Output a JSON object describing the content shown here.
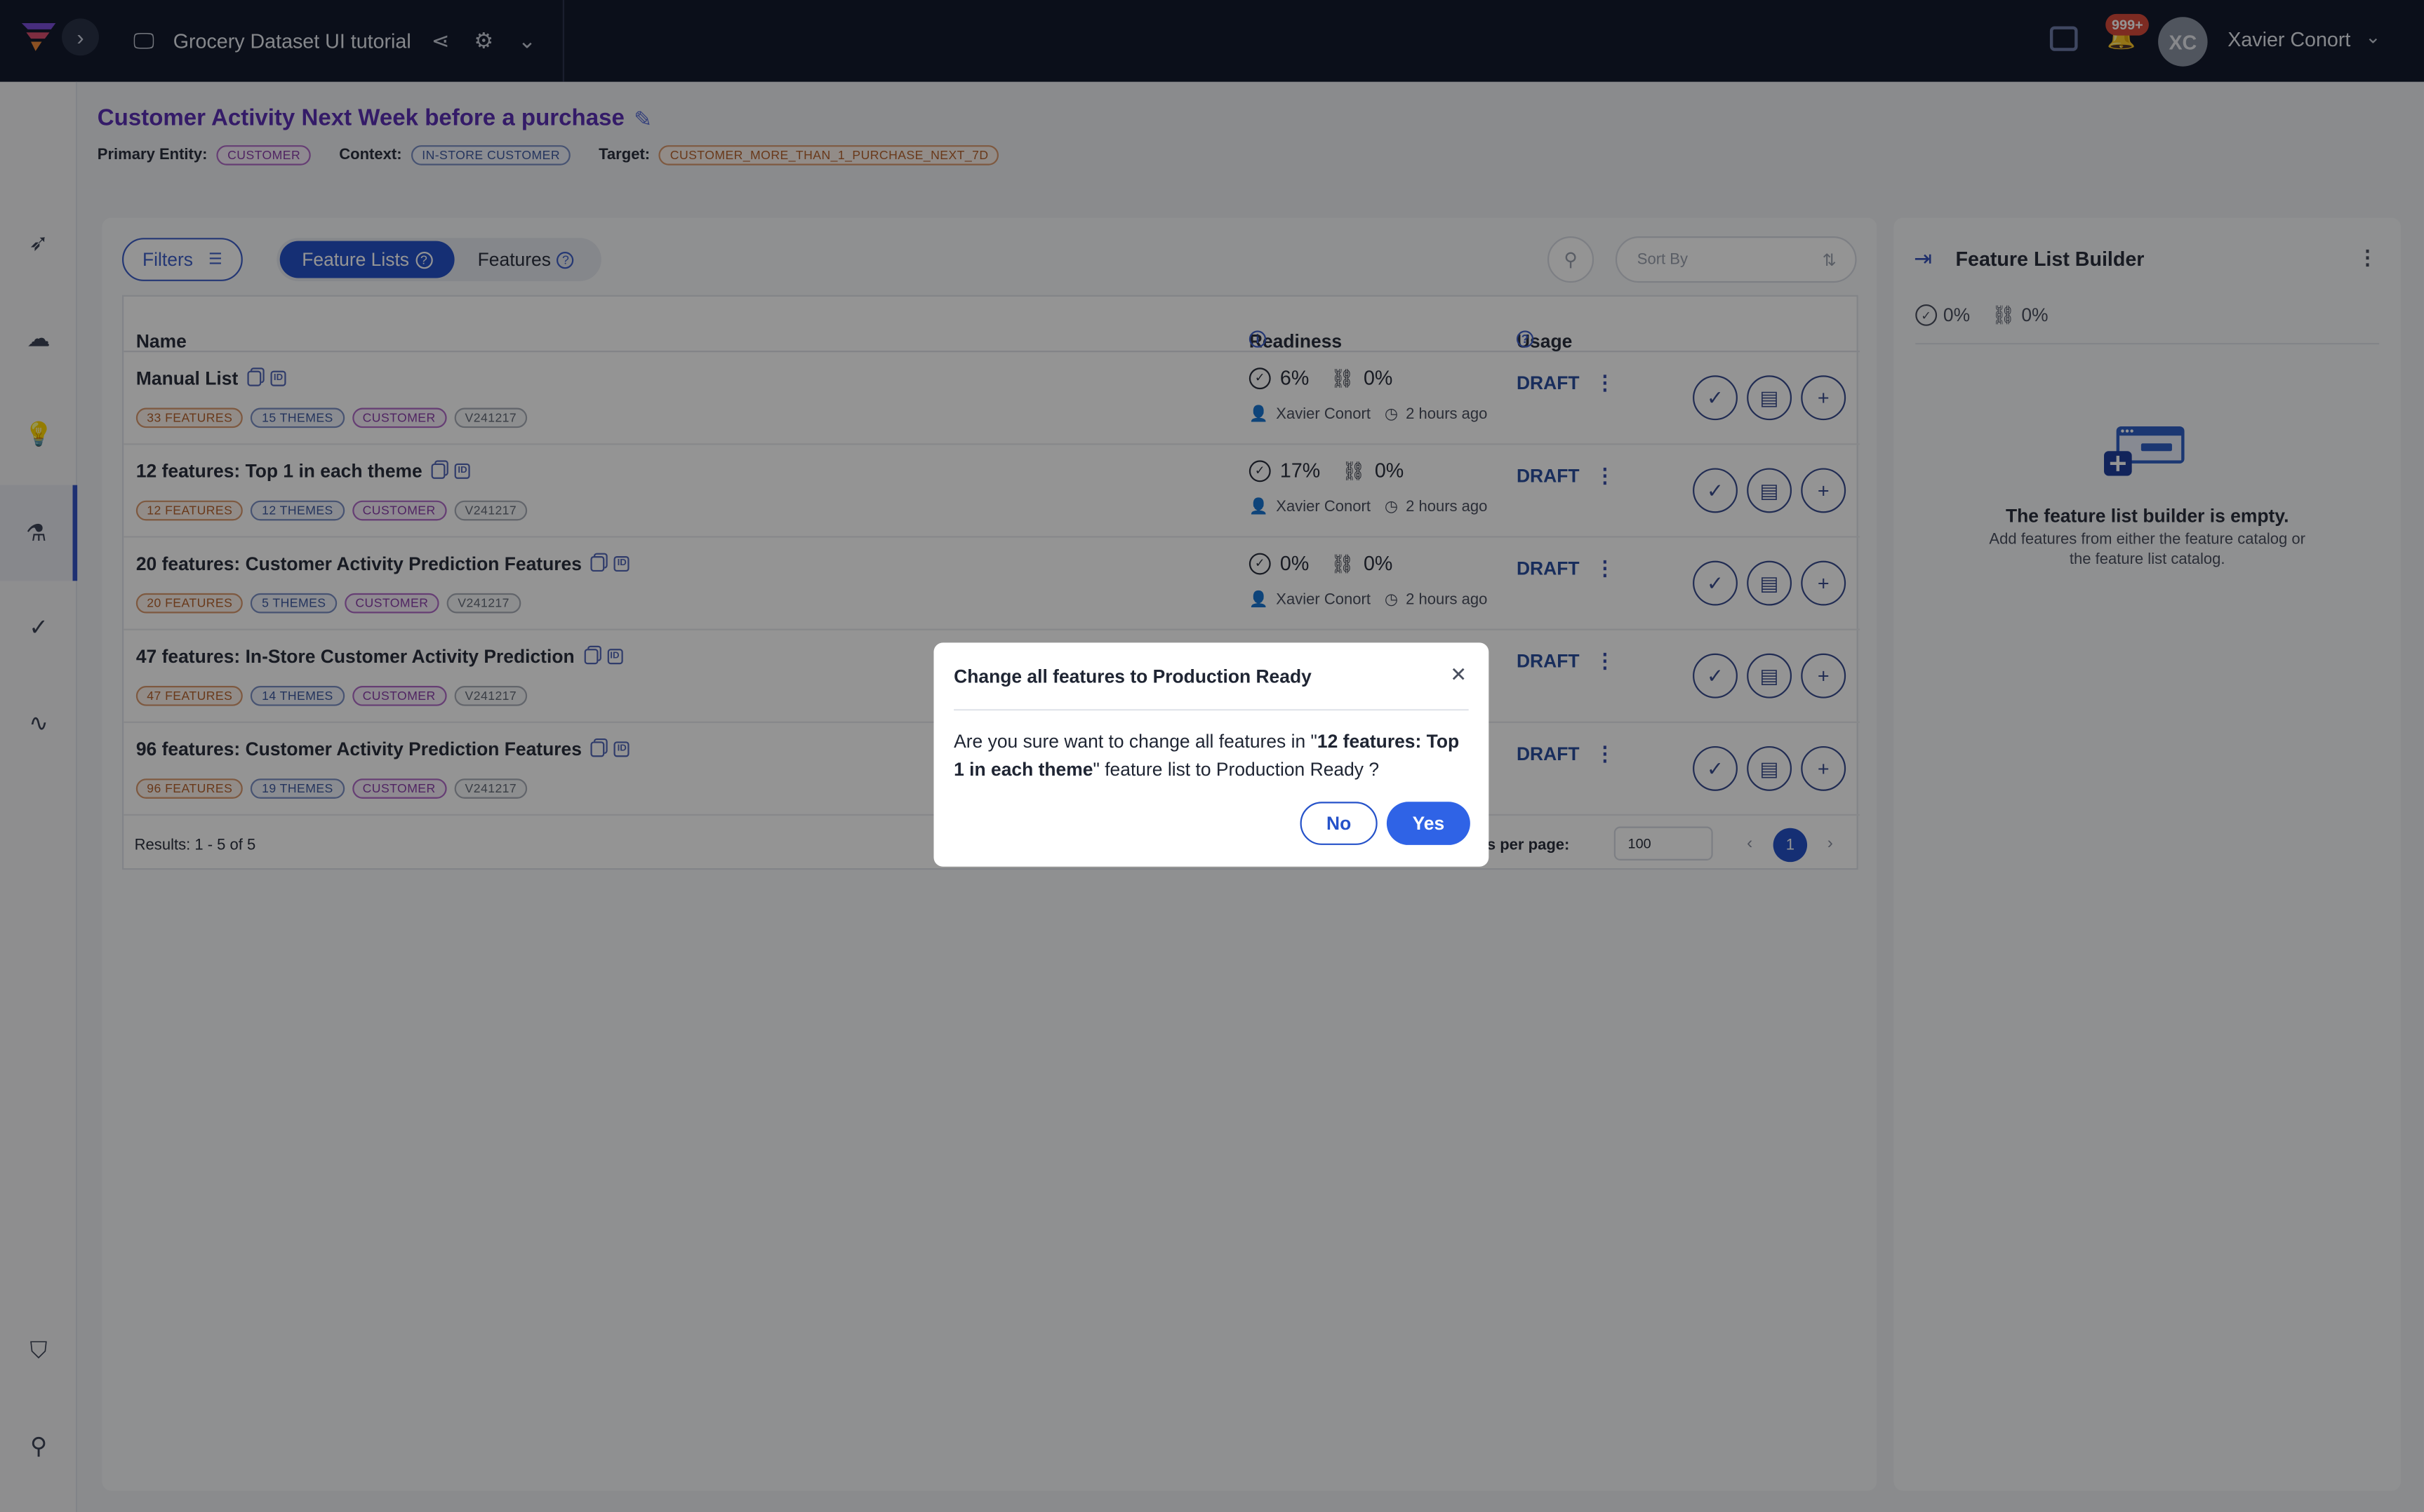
{
  "topbar": {
    "project_name": "Grocery Dataset UI tutorial",
    "notification_count": "999+",
    "avatar_initials": "XC",
    "user_name": "Xavier Conort"
  },
  "header": {
    "title": "Customer Activity Next Week before a purchase",
    "primary_entity_label": "Primary Entity:",
    "primary_entity": "CUSTOMER",
    "context_label": "Context:",
    "context": "IN-STORE CUSTOMER",
    "target_label": "Target:",
    "target": "CUSTOMER_MORE_THAN_1_PURCHASE_NEXT_7D"
  },
  "toolbar": {
    "filters_label": "Filters",
    "tab_feature_lists": "Feature Lists",
    "tab_features": "Features",
    "sort_placeholder": "Sort By"
  },
  "table": {
    "col_name": "Name",
    "col_readiness": "Readiness",
    "col_usage": "Usage",
    "rows": [
      {
        "name": "Manual List",
        "features": "33 FEATURES",
        "themes": "15 THEMES",
        "entity": "CUSTOMER",
        "version": "V241217",
        "ready": "6%",
        "online": "0%",
        "owner": "Xavier Conort",
        "time": "2 hours ago",
        "status": "DRAFT"
      },
      {
        "name": "12 features: Top 1 in each theme",
        "features": "12 FEATURES",
        "themes": "12 THEMES",
        "entity": "CUSTOMER",
        "version": "V241217",
        "ready": "17%",
        "online": "0%",
        "owner": "Xavier Conort",
        "time": "2 hours ago",
        "status": "DRAFT"
      },
      {
        "name": "20 features: Customer Activity Prediction Features",
        "features": "20 FEATURES",
        "themes": "5 THEMES",
        "entity": "CUSTOMER",
        "version": "V241217",
        "ready": "0%",
        "online": "0%",
        "owner": "Xavier Conort",
        "time": "2 hours ago",
        "status": "DRAFT"
      },
      {
        "name": "47 features: In-Store Customer Activity Prediction",
        "features": "47 FEATURES",
        "themes": "14 THEMES",
        "entity": "CUSTOMER",
        "version": "V241217",
        "status": "DRAFT"
      },
      {
        "name": "96 features: Customer Activity Prediction Features",
        "features": "96 FEATURES",
        "themes": "19 THEMES",
        "entity": "CUSTOMER",
        "version": "V241217",
        "status": "DRAFT"
      }
    ],
    "results_text": "Results: 1 - 5 of 5",
    "rows_per_page_label": "ows per page:",
    "rows_per_page_value": "100",
    "current_page": "1"
  },
  "right_panel": {
    "title": "Feature List Builder",
    "ready_pct": "0%",
    "online_pct": "0%",
    "empty_title": "The feature list builder is empty.",
    "empty_sub": "Add features from either the feature catalog or the feature list catalog."
  },
  "modal": {
    "title": "Change all features to Production Ready",
    "body_prefix": "Are you sure want to change all features in \"",
    "body_bold": "12 features: Top 1 in each theme",
    "body_suffix": "\" feature list to Production Ready ?",
    "no_label": "No",
    "yes_label": "Yes"
  },
  "colors": {
    "accent": "#2552c9",
    "title_purple": "#5a2fb3",
    "topbar": "#141b2e"
  }
}
